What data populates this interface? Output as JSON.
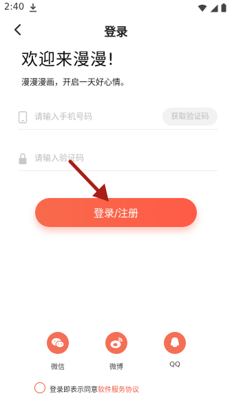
{
  "status_bar": {
    "time": "2:40"
  },
  "header": {
    "title": "登录"
  },
  "welcome": {
    "title": "欢迎来漫漫!",
    "subtitle": "漫漫漫画，开启一天好心情。"
  },
  "phone_field": {
    "placeholder": "请输入手机号码",
    "value": ""
  },
  "get_code_button": {
    "label": "获取验证码"
  },
  "code_field": {
    "placeholder": "请输入验证码",
    "value": ""
  },
  "login_button": {
    "label": "登录/注册"
  },
  "social": {
    "items": [
      {
        "label": "微信",
        "icon": "wechat-icon"
      },
      {
        "label": "微博",
        "icon": "weibo-icon"
      },
      {
        "label": "QQ",
        "icon": "qq-icon"
      }
    ]
  },
  "agreement": {
    "prefix": "登录即表示同意",
    "link": "软件服务协议"
  },
  "colors": {
    "accent": "#f0583f",
    "button_gradient_start": "#f86a4c",
    "button_gradient_end": "#ff5b46"
  }
}
